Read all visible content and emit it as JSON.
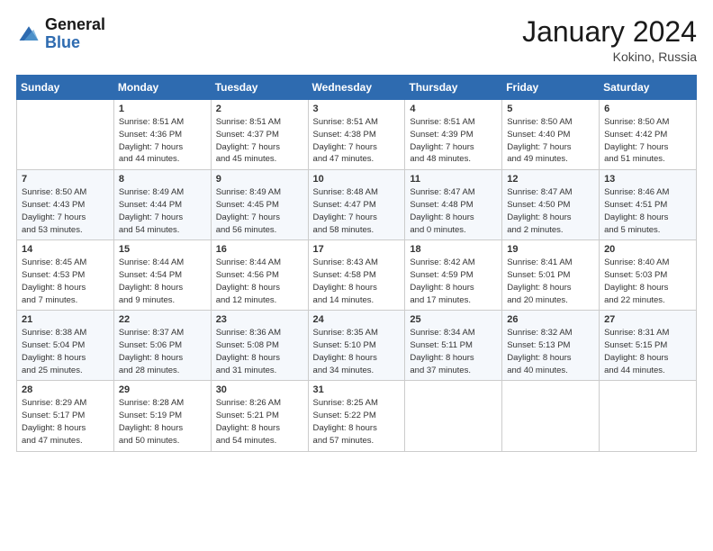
{
  "header": {
    "logo_line1": "General",
    "logo_line2": "Blue",
    "month": "January 2024",
    "location": "Kokino, Russia"
  },
  "days_of_week": [
    "Sunday",
    "Monday",
    "Tuesday",
    "Wednesday",
    "Thursday",
    "Friday",
    "Saturday"
  ],
  "weeks": [
    [
      {
        "day": "",
        "info": ""
      },
      {
        "day": "1",
        "info": "Sunrise: 8:51 AM\nSunset: 4:36 PM\nDaylight: 7 hours\nand 44 minutes."
      },
      {
        "day": "2",
        "info": "Sunrise: 8:51 AM\nSunset: 4:37 PM\nDaylight: 7 hours\nand 45 minutes."
      },
      {
        "day": "3",
        "info": "Sunrise: 8:51 AM\nSunset: 4:38 PM\nDaylight: 7 hours\nand 47 minutes."
      },
      {
        "day": "4",
        "info": "Sunrise: 8:51 AM\nSunset: 4:39 PM\nDaylight: 7 hours\nand 48 minutes."
      },
      {
        "day": "5",
        "info": "Sunrise: 8:50 AM\nSunset: 4:40 PM\nDaylight: 7 hours\nand 49 minutes."
      },
      {
        "day": "6",
        "info": "Sunrise: 8:50 AM\nSunset: 4:42 PM\nDaylight: 7 hours\nand 51 minutes."
      }
    ],
    [
      {
        "day": "7",
        "info": "Sunrise: 8:50 AM\nSunset: 4:43 PM\nDaylight: 7 hours\nand 53 minutes."
      },
      {
        "day": "8",
        "info": "Sunrise: 8:49 AM\nSunset: 4:44 PM\nDaylight: 7 hours\nand 54 minutes."
      },
      {
        "day": "9",
        "info": "Sunrise: 8:49 AM\nSunset: 4:45 PM\nDaylight: 7 hours\nand 56 minutes."
      },
      {
        "day": "10",
        "info": "Sunrise: 8:48 AM\nSunset: 4:47 PM\nDaylight: 7 hours\nand 58 minutes."
      },
      {
        "day": "11",
        "info": "Sunrise: 8:47 AM\nSunset: 4:48 PM\nDaylight: 8 hours\nand 0 minutes."
      },
      {
        "day": "12",
        "info": "Sunrise: 8:47 AM\nSunset: 4:50 PM\nDaylight: 8 hours\nand 2 minutes."
      },
      {
        "day": "13",
        "info": "Sunrise: 8:46 AM\nSunset: 4:51 PM\nDaylight: 8 hours\nand 5 minutes."
      }
    ],
    [
      {
        "day": "14",
        "info": "Sunrise: 8:45 AM\nSunset: 4:53 PM\nDaylight: 8 hours\nand 7 minutes."
      },
      {
        "day": "15",
        "info": "Sunrise: 8:44 AM\nSunset: 4:54 PM\nDaylight: 8 hours\nand 9 minutes."
      },
      {
        "day": "16",
        "info": "Sunrise: 8:44 AM\nSunset: 4:56 PM\nDaylight: 8 hours\nand 12 minutes."
      },
      {
        "day": "17",
        "info": "Sunrise: 8:43 AM\nSunset: 4:58 PM\nDaylight: 8 hours\nand 14 minutes."
      },
      {
        "day": "18",
        "info": "Sunrise: 8:42 AM\nSunset: 4:59 PM\nDaylight: 8 hours\nand 17 minutes."
      },
      {
        "day": "19",
        "info": "Sunrise: 8:41 AM\nSunset: 5:01 PM\nDaylight: 8 hours\nand 20 minutes."
      },
      {
        "day": "20",
        "info": "Sunrise: 8:40 AM\nSunset: 5:03 PM\nDaylight: 8 hours\nand 22 minutes."
      }
    ],
    [
      {
        "day": "21",
        "info": "Sunrise: 8:38 AM\nSunset: 5:04 PM\nDaylight: 8 hours\nand 25 minutes."
      },
      {
        "day": "22",
        "info": "Sunrise: 8:37 AM\nSunset: 5:06 PM\nDaylight: 8 hours\nand 28 minutes."
      },
      {
        "day": "23",
        "info": "Sunrise: 8:36 AM\nSunset: 5:08 PM\nDaylight: 8 hours\nand 31 minutes."
      },
      {
        "day": "24",
        "info": "Sunrise: 8:35 AM\nSunset: 5:10 PM\nDaylight: 8 hours\nand 34 minutes."
      },
      {
        "day": "25",
        "info": "Sunrise: 8:34 AM\nSunset: 5:11 PM\nDaylight: 8 hours\nand 37 minutes."
      },
      {
        "day": "26",
        "info": "Sunrise: 8:32 AM\nSunset: 5:13 PM\nDaylight: 8 hours\nand 40 minutes."
      },
      {
        "day": "27",
        "info": "Sunrise: 8:31 AM\nSunset: 5:15 PM\nDaylight: 8 hours\nand 44 minutes."
      }
    ],
    [
      {
        "day": "28",
        "info": "Sunrise: 8:29 AM\nSunset: 5:17 PM\nDaylight: 8 hours\nand 47 minutes."
      },
      {
        "day": "29",
        "info": "Sunrise: 8:28 AM\nSunset: 5:19 PM\nDaylight: 8 hours\nand 50 minutes."
      },
      {
        "day": "30",
        "info": "Sunrise: 8:26 AM\nSunset: 5:21 PM\nDaylight: 8 hours\nand 54 minutes."
      },
      {
        "day": "31",
        "info": "Sunrise: 8:25 AM\nSunset: 5:22 PM\nDaylight: 8 hours\nand 57 minutes."
      },
      {
        "day": "",
        "info": ""
      },
      {
        "day": "",
        "info": ""
      },
      {
        "day": "",
        "info": ""
      }
    ]
  ]
}
